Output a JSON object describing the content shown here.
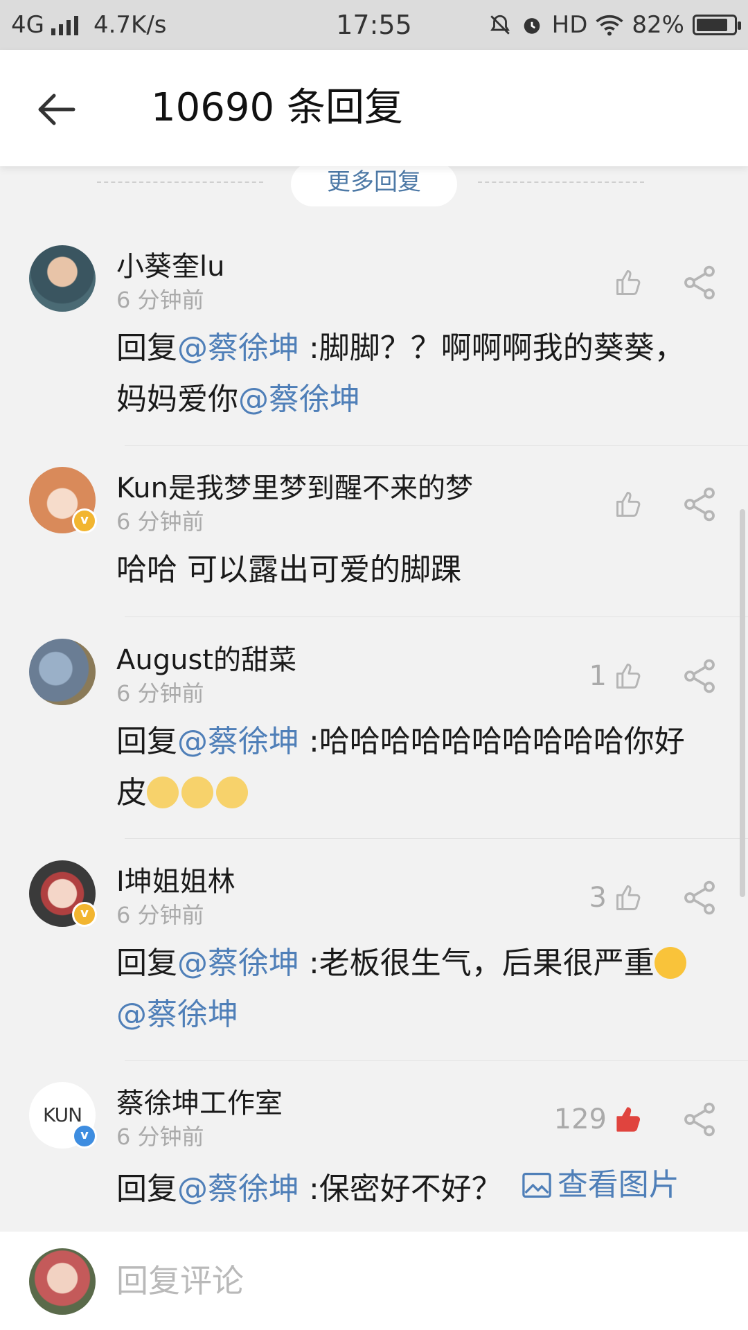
{
  "status_bar": {
    "network": "4G",
    "speed": "4.7K/s",
    "time": "17:55",
    "hd": "HD",
    "battery": "82%",
    "battery_level": 0.82
  },
  "header": {
    "title": "10690 条回复"
  },
  "more_replies": "更多回复",
  "comments": [
    {
      "name": "小葵奎lu",
      "time": "6 分钟前",
      "likes": "",
      "body": [
        [
          "回复",
          ""
        ],
        [
          "@蔡徐坤",
          "mention"
        ],
        [
          " :脚脚？？啊啊啊我的葵葵，妈妈爱你",
          ""
        ],
        [
          "@蔡徐坤",
          "mention"
        ]
      ]
    },
    {
      "name": "Kun是我梦里梦到醒不来的梦",
      "time": "6 分钟前",
      "likes": "",
      "body": [
        [
          "哈哈 可以露出可爱的脚踝",
          ""
        ]
      ]
    },
    {
      "name": "August的甜菜",
      "time": "6 分钟前",
      "likes": "1",
      "body": [
        [
          "回复",
          ""
        ],
        [
          "@蔡徐坤",
          "mention"
        ],
        [
          " :哈哈哈哈哈哈哈哈哈哈你好皮",
          ""
        ]
      ]
    },
    {
      "name": "I坤姐姐林",
      "time": "6 分钟前",
      "likes": "3",
      "body": [
        [
          "回复",
          ""
        ],
        [
          "@蔡徐坤",
          "mention"
        ],
        [
          " :老板很生气，后果很严重",
          ""
        ]
      ]
    },
    {
      "name": "蔡徐坤工作室",
      "time": "6 分钟前",
      "likes": "129",
      "body": [
        [
          "回复",
          ""
        ],
        [
          "@蔡徐坤",
          "mention"
        ],
        [
          " :保密好不好？",
          ""
        ]
      ],
      "view_image": "查看图片",
      "avatar_text": "KUN"
    }
  ],
  "reply_placeholder": "回复评论",
  "colors": {
    "mention": "#4f7fb8",
    "liked": "#e0443e",
    "muted": "#aaaaaa"
  },
  "icons": [
    "back-arrow-icon",
    "thumb-up-icon",
    "share-icon",
    "verified-badge-icon",
    "image-icon",
    "doge-emoji-icon",
    "grin-emoji-icon"
  ]
}
